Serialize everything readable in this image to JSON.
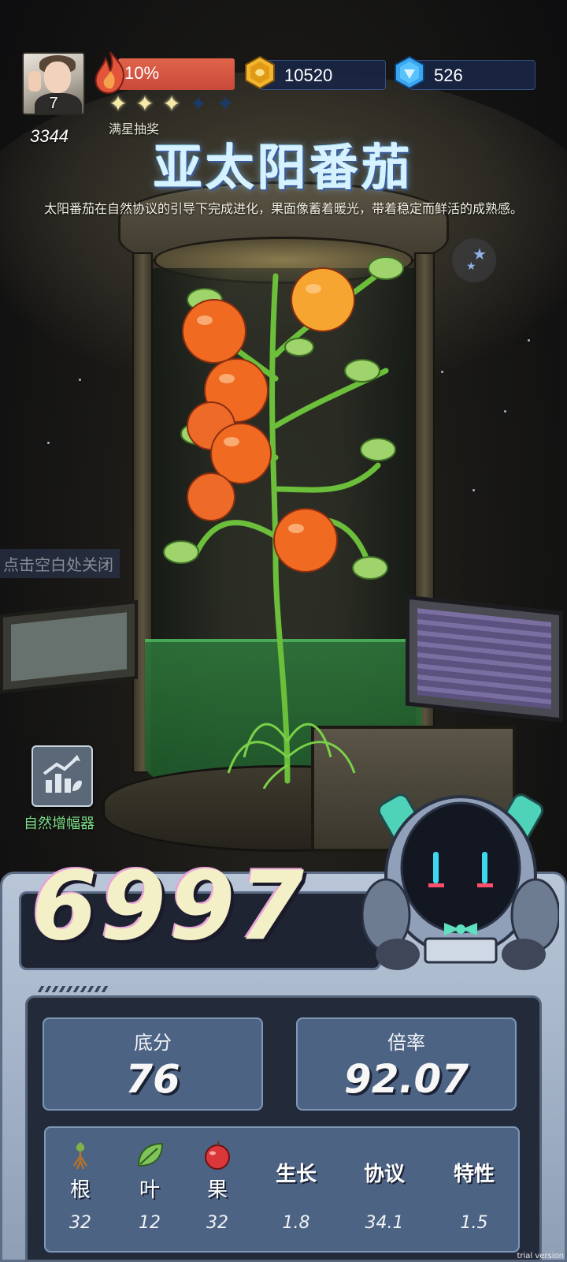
{
  "player": {
    "level": "7",
    "score": "3344"
  },
  "progress": {
    "percent_label": "10%",
    "stars_filled": 3,
    "stars_total": 5,
    "lottery_label": "满星抽奖"
  },
  "currencies": {
    "gold": "10520",
    "gems": "526"
  },
  "plant": {
    "name": "亚太阳番茄",
    "description": "太阳番茄在自然协议的引导下完成进化，果面像蓄着暖光，带着稳定而鲜活的成熟感。"
  },
  "hints": {
    "close": "点击空白处关闭"
  },
  "tools": {
    "amplifier_label": "自然增幅器"
  },
  "result": {
    "total": "6997",
    "base_label": "底分",
    "base_value": "76",
    "multiplier_label": "倍率",
    "multiplier_value": "92.07"
  },
  "stats": [
    {
      "label": "根",
      "value": "32",
      "icon": "root-icon"
    },
    {
      "label": "叶",
      "value": "12",
      "icon": "leaf-icon"
    },
    {
      "label": "果",
      "value": "32",
      "icon": "fruit-icon"
    },
    {
      "label": "生长",
      "value": "1.8"
    },
    {
      "label": "协议",
      "value": "34.1"
    },
    {
      "label": "特性",
      "value": "1.5"
    }
  ],
  "watermark": "trial version",
  "colors": {
    "fire": "#d9553f",
    "gold": "#f2b630",
    "gem": "#3aa6ef",
    "tomato": "#f06a22",
    "panel": "#4c6384",
    "accent_green": "#7fe08a"
  }
}
